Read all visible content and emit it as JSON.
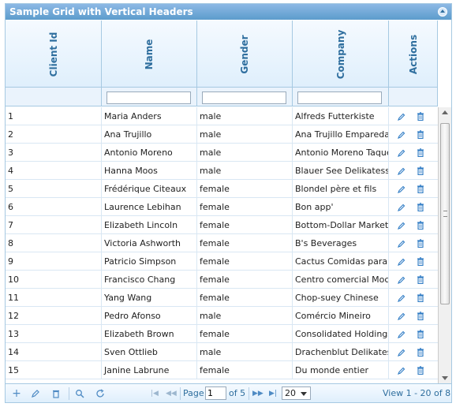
{
  "grid": {
    "title": "Sample Grid with Vertical Headers",
    "columns": [
      "Client Id",
      "Name",
      "Gender",
      "Company",
      "Actions"
    ],
    "rows": [
      {
        "id": "1",
        "name": "Maria Anders",
        "gender": "male",
        "company": "Alfreds Futterkiste"
      },
      {
        "id": "2",
        "name": "Ana Trujillo",
        "gender": "male",
        "company": "Ana Trujillo Emparedados"
      },
      {
        "id": "3",
        "name": "Antonio Moreno",
        "gender": "male",
        "company": "Antonio Moreno Taquería"
      },
      {
        "id": "4",
        "name": "Hanna Moos",
        "gender": "male",
        "company": "Blauer See Delikatessen"
      },
      {
        "id": "5",
        "name": "Frédérique Citeaux",
        "gender": "female",
        "company": "Blondel père et fils"
      },
      {
        "id": "6",
        "name": "Laurence Lebihan",
        "gender": "female",
        "company": "Bon app'"
      },
      {
        "id": "7",
        "name": "Elizabeth Lincoln",
        "gender": "female",
        "company": "Bottom-Dollar Markets"
      },
      {
        "id": "8",
        "name": "Victoria Ashworth",
        "gender": "female",
        "company": "B's Beverages"
      },
      {
        "id": "9",
        "name": "Patricio Simpson",
        "gender": "female",
        "company": "Cactus Comidas para llevar"
      },
      {
        "id": "10",
        "name": "Francisco Chang",
        "gender": "female",
        "company": "Centro comercial Moctezuma"
      },
      {
        "id": "11",
        "name": "Yang Wang",
        "gender": "female",
        "company": "Chop-suey Chinese"
      },
      {
        "id": "12",
        "name": "Pedro Afonso",
        "gender": "male",
        "company": "Comércio Mineiro"
      },
      {
        "id": "13",
        "name": "Elizabeth Brown",
        "gender": "female",
        "company": "Consolidated Holdings"
      },
      {
        "id": "14",
        "name": "Sven Ottlieb",
        "gender": "male",
        "company": "Drachenblut Delikatessen"
      },
      {
        "id": "15",
        "name": "Janine Labrune",
        "gender": "female",
        "company": "Du monde entier"
      }
    ]
  },
  "pager": {
    "page_label": "Page",
    "page_value": "1",
    "of_label": "of 5",
    "rows_per_page": "20",
    "view_text": "View 1 - 20 of 88"
  },
  "colors": {
    "title_bg": "#5c9ccc",
    "header_text": "#2e6e9e",
    "border": "#a6c9e2"
  }
}
